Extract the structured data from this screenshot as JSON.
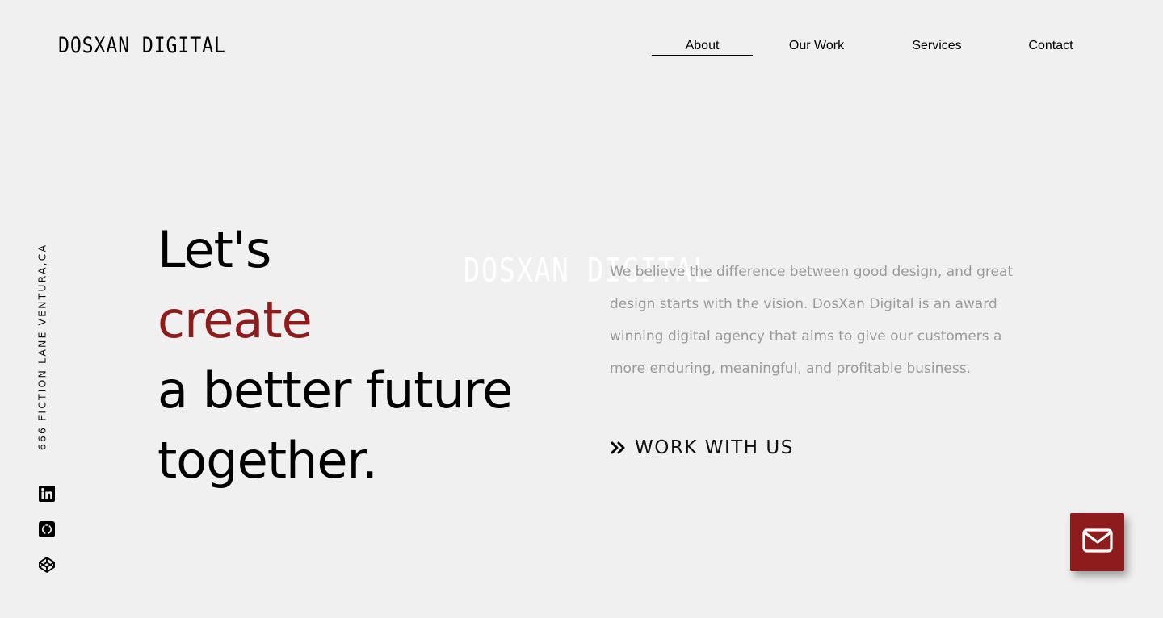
{
  "brand": {
    "logo_text": "DOSXAN DIGITAL",
    "watermark_text": "DOSXAN DIGITAL"
  },
  "nav": {
    "items": [
      {
        "label": "About",
        "active": true
      },
      {
        "label": "Our Work",
        "active": false
      },
      {
        "label": "Services",
        "active": false
      },
      {
        "label": "Contact",
        "active": false
      }
    ]
  },
  "address": "666 FICTION LANE VENTURA,CA",
  "social": {
    "icons": [
      "linkedin-icon",
      "github-icon",
      "codepen-icon"
    ]
  },
  "hero": {
    "line1": "Let's",
    "line2": "create",
    "line3": "a better future",
    "line4": "together."
  },
  "about": {
    "description": "We believe the difference between good design, and great design starts with the vision. DosXan Digital is an award winning digital agency that aims to give our customers a more enduring, meaningful, and profitable business."
  },
  "cta": {
    "label": "WORK WITH US",
    "icon": "double-chevron-right-icon"
  },
  "floating_button": {
    "icon": "mail-icon"
  },
  "colors": {
    "background": "#f0f0f0",
    "accent": "#8e1c1c",
    "text": "#000000",
    "muted_text": "#9a9a9a"
  }
}
